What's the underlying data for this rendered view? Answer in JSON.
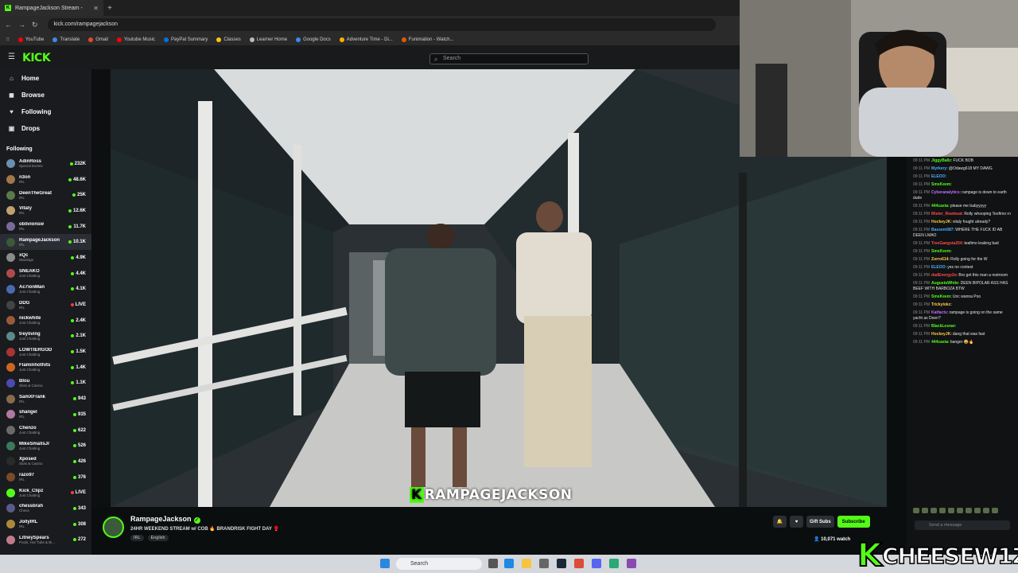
{
  "browser": {
    "tab_title": "RampageJackson Stream -",
    "url": "kick.com/rampagejackson",
    "bookmarks": [
      {
        "label": "YouTube",
        "color": "#ff0000"
      },
      {
        "label": "Translate",
        "color": "#4285f4"
      },
      {
        "label": "Gmail",
        "color": "#ea4335"
      },
      {
        "label": "Youtube Music",
        "color": "#ff0000"
      },
      {
        "label": "PayPal Summary",
        "color": "#0070e0"
      },
      {
        "label": "Classes",
        "color": "#f5c518"
      },
      {
        "label": "Learner Home",
        "color": "#bbbbbb"
      },
      {
        "label": "Google Docs",
        "color": "#4285f4"
      },
      {
        "label": "Adventure Time - Di...",
        "color": "#ffb000"
      },
      {
        "label": "Funimation - Watch...",
        "color": "#e05a00"
      }
    ]
  },
  "header": {
    "logo": "KICK",
    "search_placeholder": "Search"
  },
  "sidebar": {
    "nav": [
      {
        "label": "Home",
        "icon": "home-icon",
        "glyph": "⌂"
      },
      {
        "label": "Browse",
        "icon": "browse-icon",
        "glyph": "◼"
      },
      {
        "label": "Following",
        "icon": "heart-icon",
        "glyph": "♥"
      },
      {
        "label": "Drops",
        "icon": "gift-icon",
        "glyph": "▣"
      }
    ],
    "following_heading": "Following",
    "channels": [
      {
        "name": "AdinRoss",
        "category": "Special Events",
        "viewers": "232K",
        "live": false,
        "color": "#6b8fb0"
      },
      {
        "name": "n3on",
        "category": "IRL",
        "viewers": "48.6K",
        "live": false,
        "color": "#a0784a"
      },
      {
        "name": "DeenTheGreat",
        "category": "IRL",
        "viewers": "25K",
        "live": false,
        "color": "#5a7a4a"
      },
      {
        "name": "Vitaly",
        "category": "IRL",
        "viewers": "12.6K",
        "live": false,
        "color": "#c2a070"
      },
      {
        "name": "oblivionsw",
        "category": "IRL",
        "viewers": "11.7K",
        "live": false,
        "color": "#7a6a9a"
      },
      {
        "name": "RampageJackson",
        "category": "IRL",
        "viewers": "10.1K",
        "live": false,
        "color": "#3a5a3a"
      },
      {
        "name": "xQc",
        "category": "Wardogs",
        "viewers": "4.9K",
        "live": false,
        "color": "#8a8a8a"
      },
      {
        "name": "SNEAKO",
        "category": "Just Chatting",
        "viewers": "4.4K",
        "live": false,
        "color": "#b04a4a"
      },
      {
        "name": "Ac7ionMan",
        "category": "Just Chatting",
        "viewers": "4.1K",
        "live": false,
        "color": "#4a6ab0"
      },
      {
        "name": "DDG",
        "category": "IRL",
        "viewers": "LIVE",
        "live": true,
        "color": "#444444"
      },
      {
        "name": "nickwhite",
        "category": "Just Chatting",
        "viewers": "2.4K",
        "live": false,
        "color": "#9a5a3a"
      },
      {
        "name": "treyliving",
        "category": "Just Chatting",
        "viewers": "2.1K",
        "live": false,
        "color": "#5a8a8a"
      },
      {
        "name": "LOWTIERGOD",
        "category": "Just Chatting",
        "viewers": "1.5K",
        "live": false,
        "color": "#aa3333"
      },
      {
        "name": "Flaminhothits",
        "category": "Just Chatting",
        "viewers": "1.4K",
        "live": false,
        "color": "#cc6622"
      },
      {
        "name": "Blou",
        "category": "Slots & Casino",
        "viewers": "1.1K",
        "live": false,
        "color": "#4a4ab0"
      },
      {
        "name": "SamXFrank",
        "category": "IRL",
        "viewers": "943",
        "live": false,
        "color": "#8a6a4a"
      },
      {
        "name": "shangel",
        "category": "IRL",
        "viewers": "935",
        "live": false,
        "color": "#b07aa0"
      },
      {
        "name": "Chenzo",
        "category": "Just Chatting",
        "viewers": "622",
        "live": false,
        "color": "#6a6a6a"
      },
      {
        "name": "MikeSmallsJr",
        "category": "Just Chatting",
        "viewers": "526",
        "live": false,
        "color": "#3a7a5a"
      },
      {
        "name": "Xposed",
        "category": "Slots & Casino",
        "viewers": "426",
        "live": false,
        "color": "#2a2a2a"
      },
      {
        "name": "razo97",
        "category": "IRL",
        "viewers": "376",
        "live": false,
        "color": "#7a4a2a"
      },
      {
        "name": "Kick_Clipz",
        "category": "Just Chatting",
        "viewers": "LIVE",
        "live": true,
        "color": "#53fc18"
      },
      {
        "name": "chessbrah",
        "category": "Chess",
        "viewers": "343",
        "live": false,
        "color": "#5a5a8a"
      },
      {
        "name": "JollyIRL",
        "category": "IRL",
        "viewers": "308",
        "live": false,
        "color": "#aa8a3a"
      },
      {
        "name": "LitneySpears",
        "category": "Pools, Hot Tubs & Bi...",
        "viewers": "272",
        "live": false,
        "color": "#c27a8a"
      }
    ]
  },
  "video": {
    "caption_k": "K",
    "caption_rest": "RAMPAGEJACKSON"
  },
  "stream": {
    "name": "RampageJackson",
    "title": "24HR WEEKEND STREAM w/ COB 🔥 BRANDRISK FIGHT DAY 🥊",
    "tags": [
      "IRL",
      "English"
    ],
    "gift_label": "Gift Subs",
    "subscribe_label": "Subscribe",
    "viewers": "10,071 watch"
  },
  "chat": {
    "input_placeholder": "Send a message",
    "messages": [
      {
        "time": "09:11 PM",
        "user": "JiggyBallz:",
        "color": "#53fc18",
        "text": "FUCK BOB"
      },
      {
        "time": "09:11 PM",
        "user": "Myrkery:",
        "color": "#4ab0ff",
        "text": "@Odawg618 MY DAWG"
      },
      {
        "time": "09:11 PM",
        "user": "ELEOO:",
        "color": "#4ab0ff",
        "text": ""
      },
      {
        "time": "09:11 PM",
        "user": "SmsKeem:",
        "color": "#53fc18",
        "text": ""
      },
      {
        "time": "09:11 PM",
        "user": "Cyberanalytics:",
        "color": "#c070ff",
        "text": "rampage is down to earth dude"
      },
      {
        "time": "09:11 PM",
        "user": "444casta:",
        "color": "#53fc18",
        "text": "please me babyyyyy"
      },
      {
        "time": "09:11 PM",
        "user": "Mister_Rowboat:",
        "color": "#ff4a4a",
        "text": "Rolly whooping Teofimo rn"
      },
      {
        "time": "09:11 PM",
        "user": "HockeyJK:",
        "color": "#ffcc44",
        "text": "vitaly fought already?"
      },
      {
        "time": "09:11 PM",
        "user": "Bassem587:",
        "color": "#4ab0ff",
        "text": "WHERE THE FUCK ID AB DEEN LMAO"
      },
      {
        "time": "09:11 PM",
        "user": "TreeGangsta254:",
        "color": "#ff4a4a",
        "text": "teafimo leaking bad"
      },
      {
        "time": "09:11 PM",
        "user": "SmsKeem:",
        "color": "#53fc18",
        "text": ""
      },
      {
        "time": "09:11 PM",
        "user": "Zorro614:",
        "color": "#ffcc44",
        "text": "Rolly going for the W"
      },
      {
        "time": "09:11 PM",
        "user": "ELEOO:",
        "color": "#4ab0ff",
        "text": "yes no contest"
      },
      {
        "time": "09:11 PM",
        "user": "dadEnergy2o:",
        "color": "#ff4a4a",
        "text": "Bro get this man a restroom"
      },
      {
        "time": "09:11 PM",
        "user": "AugustoWhite:",
        "color": "#53fc18",
        "text": "DEEN BIPOLAR ASS HAS BEEF WITH BARBOZA BTW"
      },
      {
        "time": "09:11 PM",
        "user": "SmsKeem:",
        "color": "#53fc18",
        "text": "Unc wanna Poo"
      },
      {
        "time": "09:11 PM",
        "user": "Trickylokz:",
        "color": "#ffcc44",
        "text": ""
      },
      {
        "time": "09:11 PM",
        "user": "Katfacts:",
        "color": "#c070ff",
        "text": "rampage is going on the same yacht as Deen?"
      },
      {
        "time": "09:11 PM",
        "user": "BlackLesnar:",
        "color": "#53fc18",
        "text": ""
      },
      {
        "time": "09:11 PM",
        "user": "HockeyJK:",
        "color": "#ffcc44",
        "text": "dang that was fast"
      },
      {
        "time": "09:11 PM",
        "user": "444casta:",
        "color": "#53fc18",
        "text": "banger 😂🔥"
      }
    ]
  },
  "taskbar": {
    "search_label": "Search"
  },
  "overlay": {
    "k": "K",
    "text": "CHEESEW1Z"
  }
}
